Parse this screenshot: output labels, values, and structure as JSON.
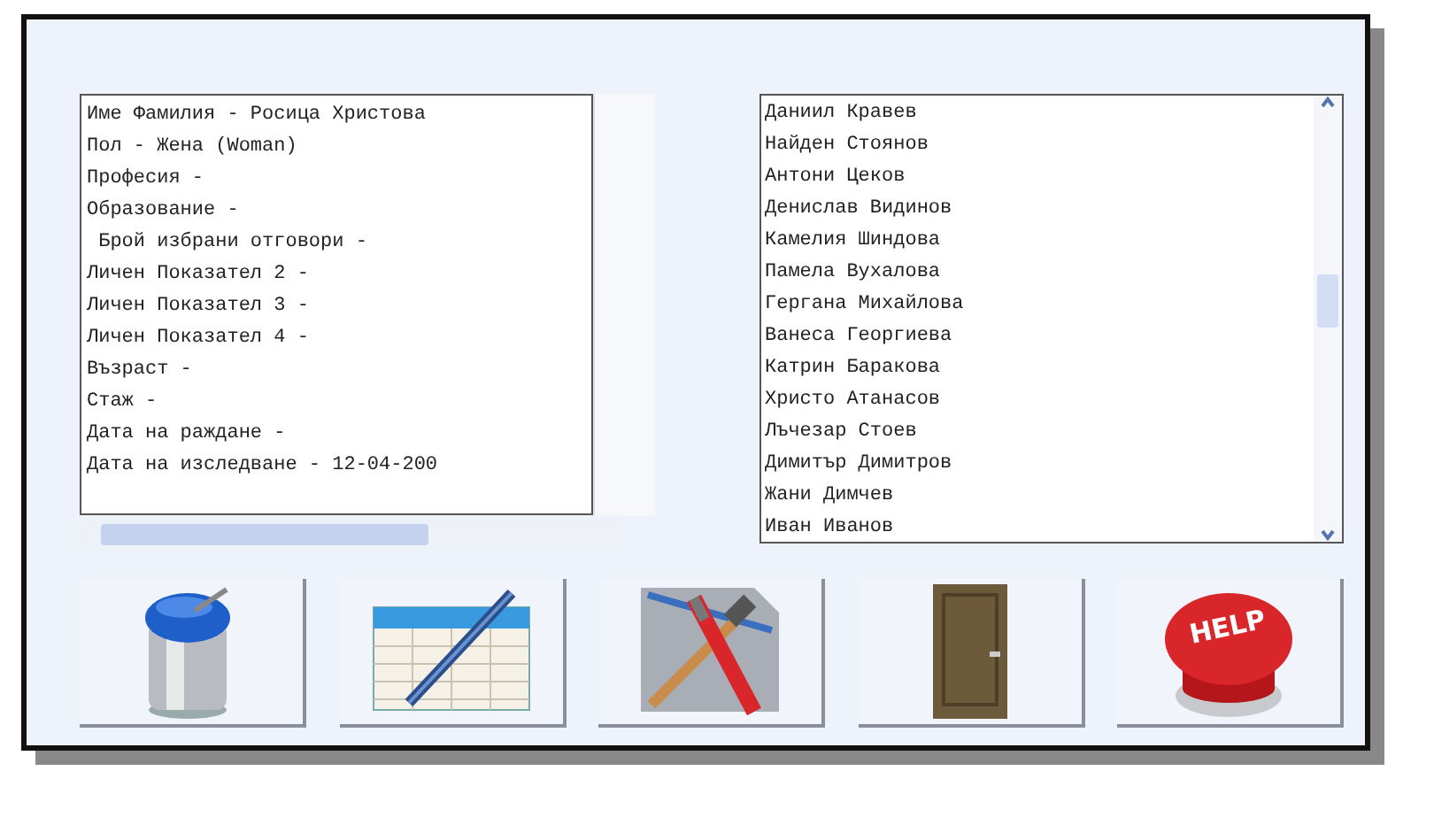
{
  "info_lines": [
    "Име Фамилия - Росица Христова",
    "Пол - Жена (Woman)",
    "Професия -",
    "Образование -",
    " Брой избрани отговори -",
    "Личен Показател 2 -",
    "Личен Показател 3 -",
    "Личен Показател 4 -",
    "Възраст -",
    "Стаж -",
    "Дата на раждане -",
    "Дата на изследване - 12-04-200"
  ],
  "people": [
    "Даниил Кравев",
    "Найден Стоянов",
    "Антони Цеков",
    "Денислав Видинов",
    "Камелия Шиндова",
    "Памела Вухалова",
    "Гергана Михайлова",
    "Ванеса Георгиева",
    "Катрин Баракова",
    "Христо Атанасов",
    "Лъчезар Стоев",
    "Димитър Димитров",
    "Жани Димчев",
    "Иван Иванов"
  ],
  "buttons": [
    {
      "kind": "trash"
    },
    {
      "kind": "table"
    },
    {
      "kind": "tools"
    },
    {
      "kind": "door"
    },
    {
      "kind": "help",
      "label": "HELP"
    }
  ]
}
